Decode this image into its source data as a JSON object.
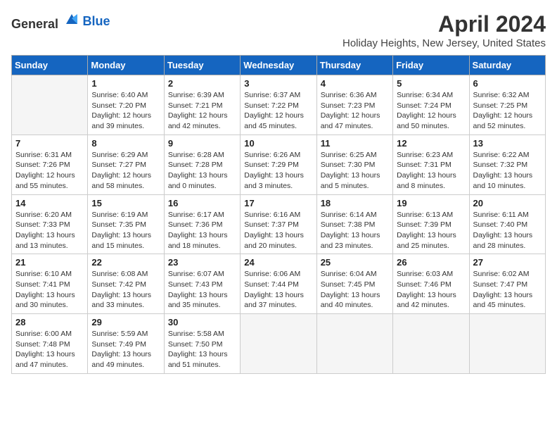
{
  "header": {
    "logo_general": "General",
    "logo_blue": "Blue",
    "title": "April 2024",
    "subtitle": "Holiday Heights, New Jersey, United States"
  },
  "calendar": {
    "weekdays": [
      "Sunday",
      "Monday",
      "Tuesday",
      "Wednesday",
      "Thursday",
      "Friday",
      "Saturday"
    ],
    "weeks": [
      [
        {
          "day": "",
          "info": ""
        },
        {
          "day": "1",
          "info": "Sunrise: 6:40 AM\nSunset: 7:20 PM\nDaylight: 12 hours\nand 39 minutes."
        },
        {
          "day": "2",
          "info": "Sunrise: 6:39 AM\nSunset: 7:21 PM\nDaylight: 12 hours\nand 42 minutes."
        },
        {
          "day": "3",
          "info": "Sunrise: 6:37 AM\nSunset: 7:22 PM\nDaylight: 12 hours\nand 45 minutes."
        },
        {
          "day": "4",
          "info": "Sunrise: 6:36 AM\nSunset: 7:23 PM\nDaylight: 12 hours\nand 47 minutes."
        },
        {
          "day": "5",
          "info": "Sunrise: 6:34 AM\nSunset: 7:24 PM\nDaylight: 12 hours\nand 50 minutes."
        },
        {
          "day": "6",
          "info": "Sunrise: 6:32 AM\nSunset: 7:25 PM\nDaylight: 12 hours\nand 52 minutes."
        }
      ],
      [
        {
          "day": "7",
          "info": "Sunrise: 6:31 AM\nSunset: 7:26 PM\nDaylight: 12 hours\nand 55 minutes."
        },
        {
          "day": "8",
          "info": "Sunrise: 6:29 AM\nSunset: 7:27 PM\nDaylight: 12 hours\nand 58 minutes."
        },
        {
          "day": "9",
          "info": "Sunrise: 6:28 AM\nSunset: 7:28 PM\nDaylight: 13 hours\nand 0 minutes."
        },
        {
          "day": "10",
          "info": "Sunrise: 6:26 AM\nSunset: 7:29 PM\nDaylight: 13 hours\nand 3 minutes."
        },
        {
          "day": "11",
          "info": "Sunrise: 6:25 AM\nSunset: 7:30 PM\nDaylight: 13 hours\nand 5 minutes."
        },
        {
          "day": "12",
          "info": "Sunrise: 6:23 AM\nSunset: 7:31 PM\nDaylight: 13 hours\nand 8 minutes."
        },
        {
          "day": "13",
          "info": "Sunrise: 6:22 AM\nSunset: 7:32 PM\nDaylight: 13 hours\nand 10 minutes."
        }
      ],
      [
        {
          "day": "14",
          "info": "Sunrise: 6:20 AM\nSunset: 7:33 PM\nDaylight: 13 hours\nand 13 minutes."
        },
        {
          "day": "15",
          "info": "Sunrise: 6:19 AM\nSunset: 7:35 PM\nDaylight: 13 hours\nand 15 minutes."
        },
        {
          "day": "16",
          "info": "Sunrise: 6:17 AM\nSunset: 7:36 PM\nDaylight: 13 hours\nand 18 minutes."
        },
        {
          "day": "17",
          "info": "Sunrise: 6:16 AM\nSunset: 7:37 PM\nDaylight: 13 hours\nand 20 minutes."
        },
        {
          "day": "18",
          "info": "Sunrise: 6:14 AM\nSunset: 7:38 PM\nDaylight: 13 hours\nand 23 minutes."
        },
        {
          "day": "19",
          "info": "Sunrise: 6:13 AM\nSunset: 7:39 PM\nDaylight: 13 hours\nand 25 minutes."
        },
        {
          "day": "20",
          "info": "Sunrise: 6:11 AM\nSunset: 7:40 PM\nDaylight: 13 hours\nand 28 minutes."
        }
      ],
      [
        {
          "day": "21",
          "info": "Sunrise: 6:10 AM\nSunset: 7:41 PM\nDaylight: 13 hours\nand 30 minutes."
        },
        {
          "day": "22",
          "info": "Sunrise: 6:08 AM\nSunset: 7:42 PM\nDaylight: 13 hours\nand 33 minutes."
        },
        {
          "day": "23",
          "info": "Sunrise: 6:07 AM\nSunset: 7:43 PM\nDaylight: 13 hours\nand 35 minutes."
        },
        {
          "day": "24",
          "info": "Sunrise: 6:06 AM\nSunset: 7:44 PM\nDaylight: 13 hours\nand 37 minutes."
        },
        {
          "day": "25",
          "info": "Sunrise: 6:04 AM\nSunset: 7:45 PM\nDaylight: 13 hours\nand 40 minutes."
        },
        {
          "day": "26",
          "info": "Sunrise: 6:03 AM\nSunset: 7:46 PM\nDaylight: 13 hours\nand 42 minutes."
        },
        {
          "day": "27",
          "info": "Sunrise: 6:02 AM\nSunset: 7:47 PM\nDaylight: 13 hours\nand 45 minutes."
        }
      ],
      [
        {
          "day": "28",
          "info": "Sunrise: 6:00 AM\nSunset: 7:48 PM\nDaylight: 13 hours\nand 47 minutes."
        },
        {
          "day": "29",
          "info": "Sunrise: 5:59 AM\nSunset: 7:49 PM\nDaylight: 13 hours\nand 49 minutes."
        },
        {
          "day": "30",
          "info": "Sunrise: 5:58 AM\nSunset: 7:50 PM\nDaylight: 13 hours\nand 51 minutes."
        },
        {
          "day": "",
          "info": ""
        },
        {
          "day": "",
          "info": ""
        },
        {
          "day": "",
          "info": ""
        },
        {
          "day": "",
          "info": ""
        }
      ]
    ]
  }
}
